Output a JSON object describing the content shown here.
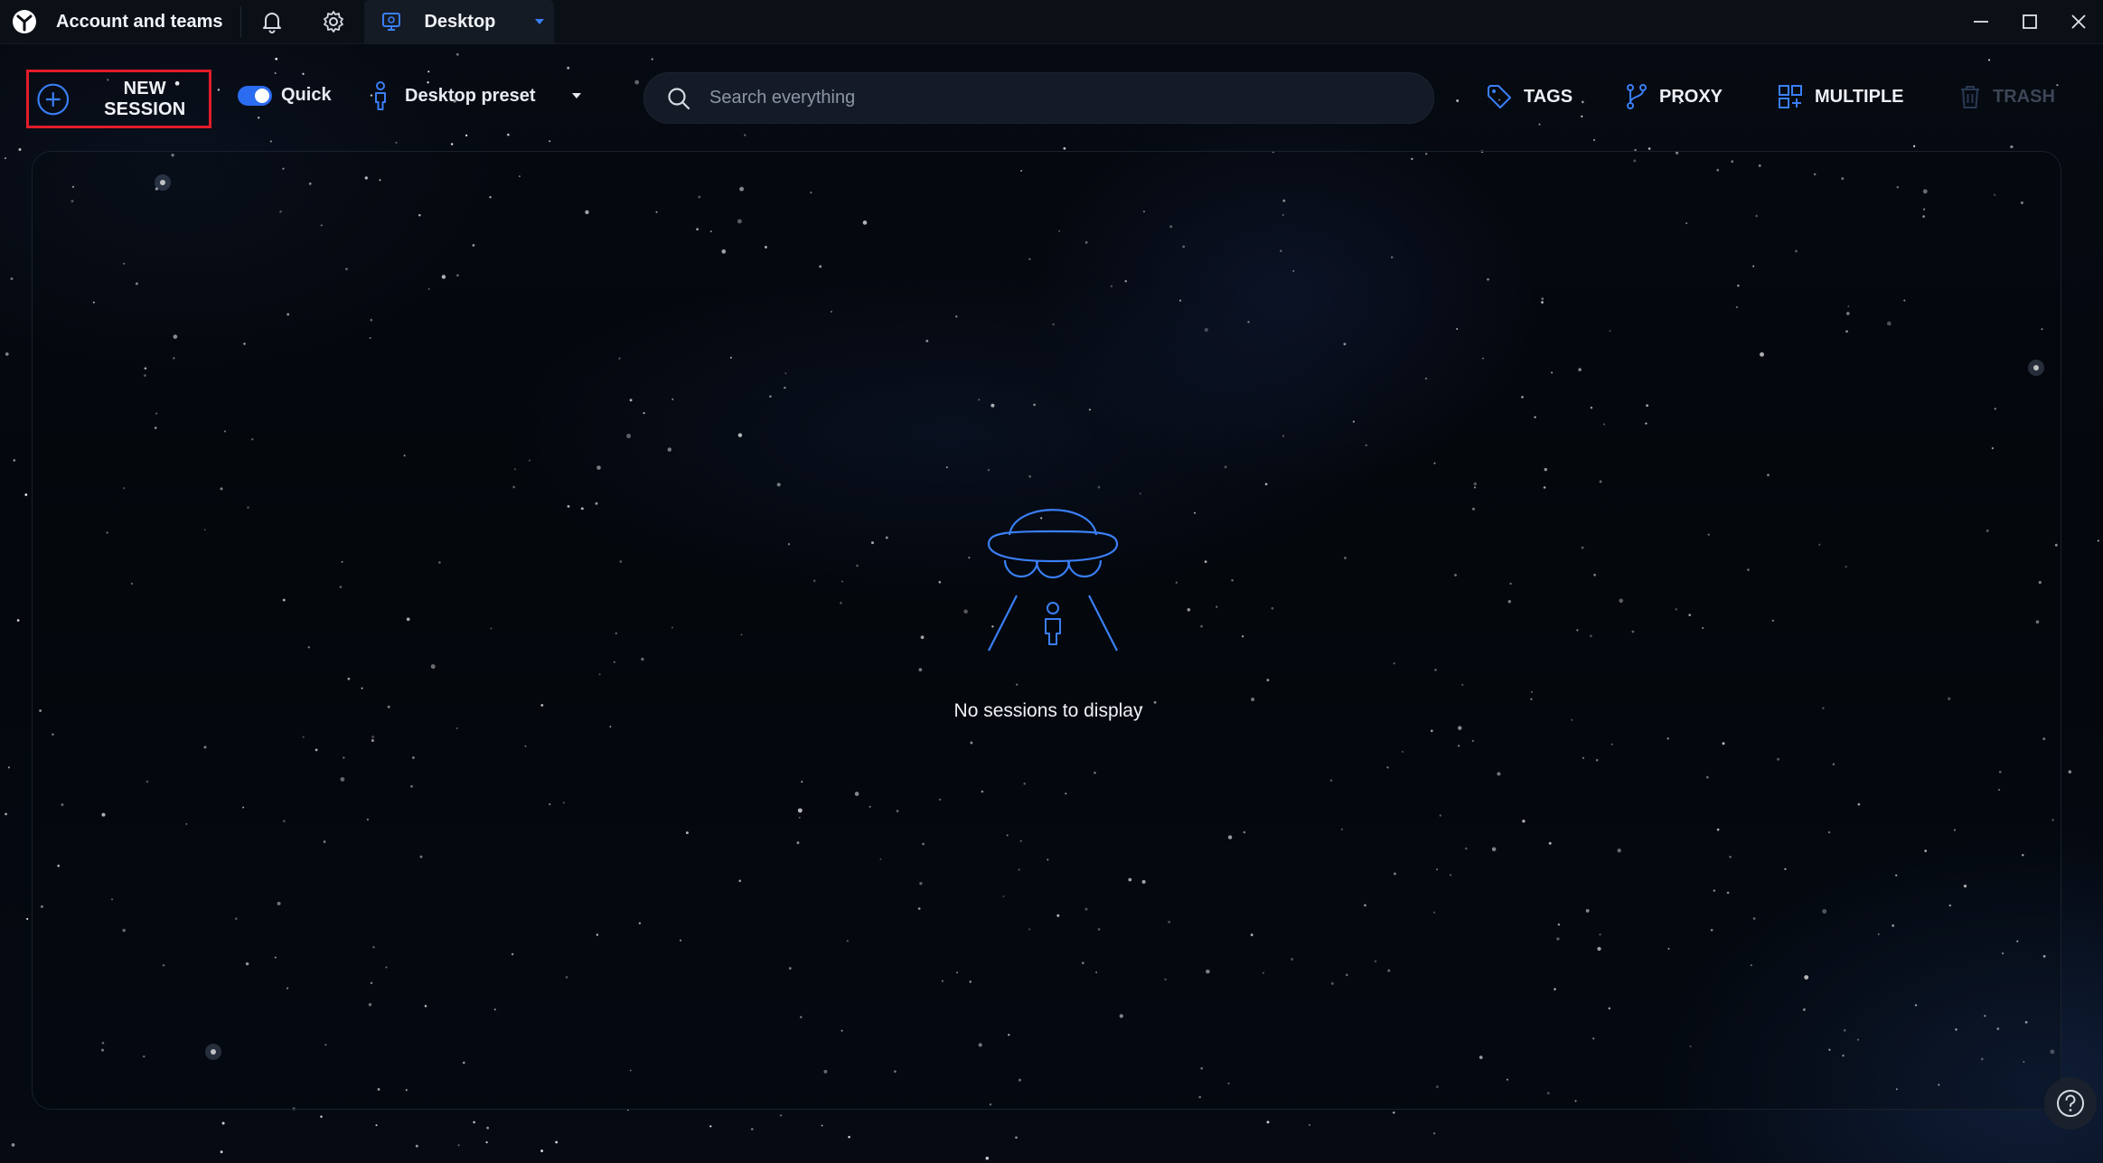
{
  "titlebar": {
    "account_label": "Account and teams",
    "active_tab": "Desktop",
    "icons": [
      "app-logo",
      "bell-icon",
      "gear-icon",
      "desktop-tab-icon",
      "chevron-down-icon",
      "minimize-icon",
      "maximize-icon",
      "close-icon"
    ]
  },
  "toolbar": {
    "new_session_label": "NEW SESSION",
    "quick_label": "Quick",
    "quick_enabled": true,
    "preset_label": "Desktop preset",
    "search_placeholder": "Search everything",
    "tags_label": "TAGS",
    "proxy_label": "PROXY",
    "multiple_label": "MULTIPLE",
    "trash_label": "TRASH",
    "trash_disabled": true
  },
  "main": {
    "empty_message": "No sessions to display",
    "empty_icon": "ufo-icon"
  },
  "colors": {
    "accent": "#2c6cf0",
    "highlight_border": "#e21c2a",
    "titlebar_bg": "#0b0f16",
    "icon_blue": "#3a7ff5"
  }
}
